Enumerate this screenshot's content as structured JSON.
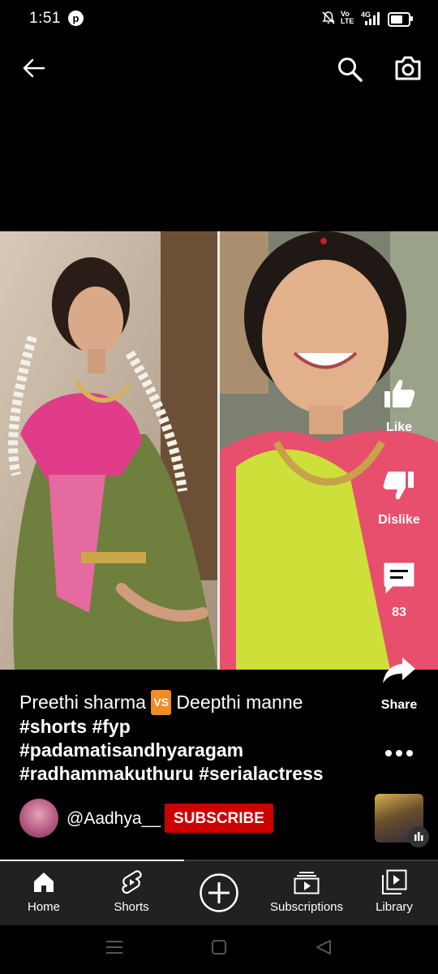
{
  "status_bar": {
    "time": "1:51",
    "app_icon": "p-circle-icon",
    "network": "4G",
    "volte": "Vo LTE",
    "icons": [
      "bell-muted-icon",
      "volte-icon",
      "signal-icon",
      "battery-icon"
    ]
  },
  "top_bar": {
    "back_icon": "arrow-left-icon",
    "search_icon": "search-icon",
    "camera_icon": "camera-icon"
  },
  "rail": {
    "like_label": "Like",
    "dislike_label": "Dislike",
    "comments_count": "83",
    "share_label": "Share"
  },
  "caption": {
    "part1": "Preethi sharma ",
    "vs": "VS",
    "part2": " Deepthi manne ",
    "tags_line1": "#shorts #fyp",
    "tags_line2": "#padamatisandhyaragam",
    "tags_line3": "#radhammakuthuru #serialactress"
  },
  "channel": {
    "handle": "@Aadhya__",
    "subscribe_label": "SUBSCRIBE"
  },
  "progress": {
    "fraction": 0.42
  },
  "bottom_nav": {
    "items": [
      {
        "label": "Home",
        "icon": "home-icon"
      },
      {
        "label": "Shorts",
        "icon": "shorts-icon"
      },
      {
        "label": "",
        "icon": "create-plus-icon"
      },
      {
        "label": "Subscriptions",
        "icon": "subscriptions-icon"
      },
      {
        "label": "Library",
        "icon": "library-icon"
      }
    ]
  },
  "colors": {
    "background": "#000000",
    "subscribe": "#cc0000",
    "nav_bar": "#212121",
    "vs_badge": "#f28b22"
  }
}
